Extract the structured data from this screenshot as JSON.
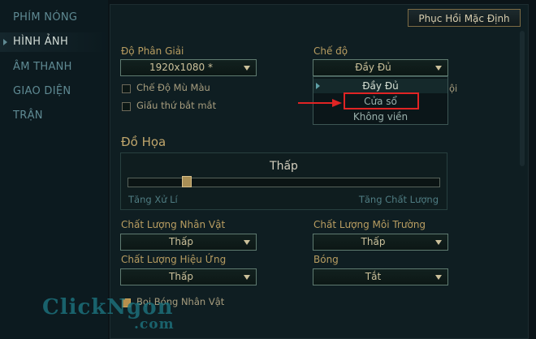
{
  "sidebar": {
    "items": [
      {
        "label": "PHÍM NÓNG"
      },
      {
        "label": "HÌNH ẢNH"
      },
      {
        "label": "ÂM THANH"
      },
      {
        "label": "GIAO DIỆN"
      },
      {
        "label": "TRẬN"
      }
    ],
    "active_index": 1
  },
  "header": {
    "reset_label": "Phục Hồi Mặc Định"
  },
  "resolution": {
    "label": "Độ Phân Giải",
    "value": "1920x1080 *"
  },
  "mode": {
    "label": "Chế độ",
    "value": "Đầy Đủ",
    "options": [
      "Đầy Đủ",
      "Cửa sổ",
      "Không viền"
    ],
    "selected_option": "Đầy Đủ",
    "highlighted_option": "Cửa sổ",
    "partial_text": "ội"
  },
  "checkboxes": {
    "colorblind": {
      "label": "Chế Độ Mù Màu",
      "checked": false
    },
    "hide_eye_candy": {
      "label": "Giấu thứ bắt mắt",
      "checked": false
    }
  },
  "graphics": {
    "section_title": "Đồ Họa",
    "level_label": "Thấp",
    "left_label": "Tăng Xử Lí",
    "right_label": "Tăng Chất Lượng",
    "slider_value": 0.18
  },
  "quality": {
    "character": {
      "label": "Chất Lượng Nhân Vật",
      "value": "Thấp"
    },
    "environment": {
      "label": "Chất Lượng Môi Trường",
      "value": "Thấp"
    },
    "effects": {
      "label": "Chất Lượng Hiệu Ứng",
      "value": "Thấp"
    },
    "shadows": {
      "label": "Bóng",
      "value": "Tắt"
    }
  },
  "character_shadow": {
    "label": "Bọi Bóng Nhân Vật",
    "checked": true
  },
  "watermark": {
    "line1": "ClickNgon",
    "line2": ".com"
  },
  "colors": {
    "accent": "#b89d61",
    "highlight": "#e02424",
    "background": "#0b1418"
  }
}
